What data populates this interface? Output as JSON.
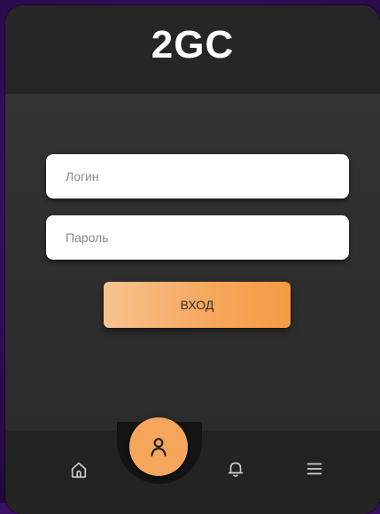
{
  "app": {
    "title": "2GC"
  },
  "form": {
    "login_placeholder": "Логин",
    "password_placeholder": "Пароль",
    "submit_label": "ВХОД"
  },
  "nav": {
    "items": [
      {
        "icon": "home-icon"
      },
      {
        "icon": "user-icon",
        "active": true
      },
      {
        "icon": "bell-icon"
      },
      {
        "icon": "menu-icon"
      }
    ]
  },
  "colors": {
    "accent": "#f6a65a",
    "header_bg": "#262626",
    "body_bg": "#2f2f2f",
    "backdrop": "#3a0f63"
  }
}
